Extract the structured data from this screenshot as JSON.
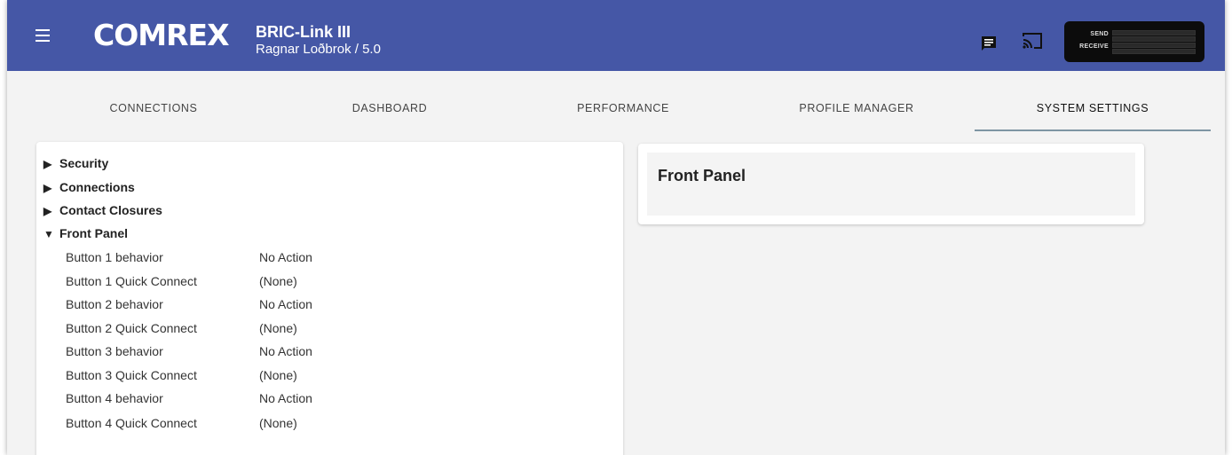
{
  "header": {
    "logo_text": "COMREX",
    "title": "BRIC-Link III",
    "subtitle": "Ragnar Loðbrok / 5.0",
    "meter": {
      "send_label": "SEND",
      "receive_label": "RECEIVE"
    },
    "icons": {
      "menu": "menu-icon",
      "chat": "chat-icon",
      "cast": "cast-icon"
    },
    "colors": {
      "header_bg": "#4557a6",
      "tab_underline": "#7e95a3"
    }
  },
  "tabs": [
    {
      "label": "CONNECTIONS",
      "active": false
    },
    {
      "label": "DASHBOARD",
      "active": false
    },
    {
      "label": "PERFORMANCE",
      "active": false
    },
    {
      "label": "PROFILE MANAGER",
      "active": false
    },
    {
      "label": "SYSTEM SETTINGS",
      "active": true
    }
  ],
  "settings_tree": {
    "sections": [
      {
        "label": "Security",
        "expanded": false
      },
      {
        "label": "Connections",
        "expanded": false
      },
      {
        "label": "Contact Closures",
        "expanded": false
      },
      {
        "label": "Front Panel",
        "expanded": true
      }
    ],
    "front_panel_rows": [
      {
        "label": "Button 1 behavior",
        "value": "No Action"
      },
      {
        "label": "Button 1 Quick Connect",
        "value": "(None)"
      },
      {
        "label": "Button 2 behavior",
        "value": "No Action"
      },
      {
        "label": "Button 2 Quick Connect",
        "value": "(None)"
      },
      {
        "label": "Button 3 behavior",
        "value": "No Action"
      },
      {
        "label": "Button 3 Quick Connect",
        "value": "(None)"
      },
      {
        "label": "Button 4 behavior",
        "value": "No Action"
      },
      {
        "label": "Button 4 Quick Connect",
        "value": "(None)"
      }
    ]
  },
  "detail_panel": {
    "title": "Front Panel"
  }
}
